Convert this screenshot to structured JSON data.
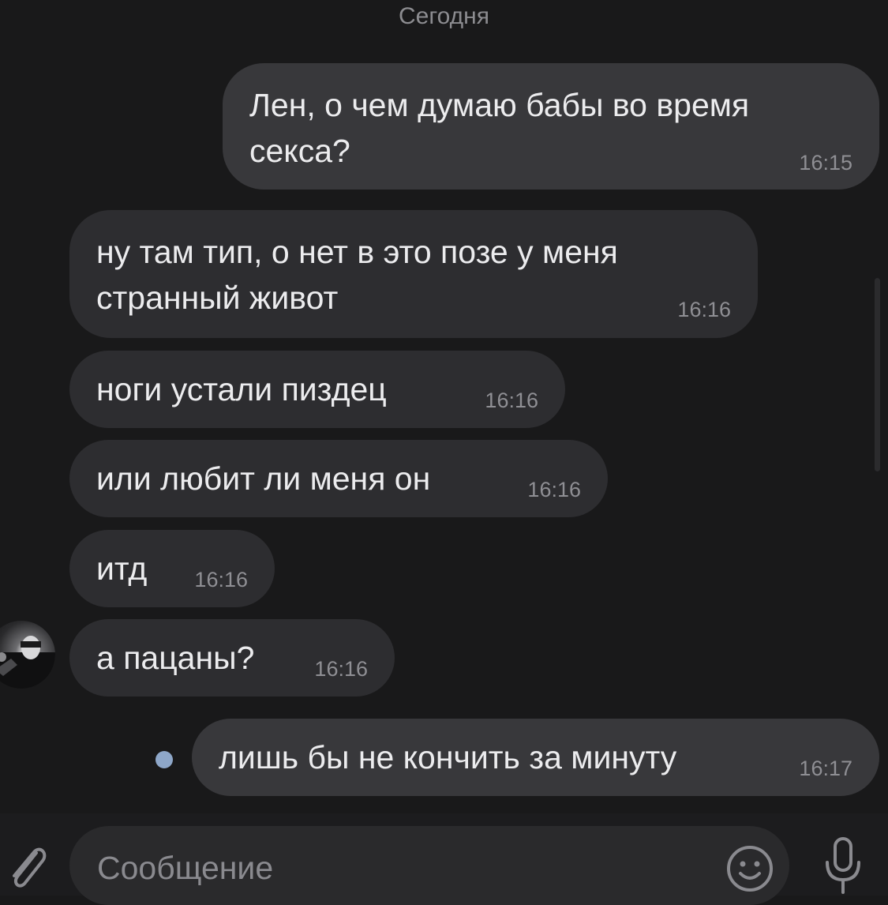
{
  "chat": {
    "day_label": "Сегодня",
    "messages": [
      {
        "direction": "outgoing",
        "lines": [
          "Лен, о чем думаю бабы во время",
          "секса?"
        ],
        "time": "16:15"
      },
      {
        "direction": "incoming",
        "lines": [
          "ну там тип, о нет в это позе у меня",
          "странный живот"
        ],
        "time": "16:16"
      },
      {
        "direction": "incoming",
        "lines": [
          "ноги устали пиздец"
        ],
        "time": "16:16"
      },
      {
        "direction": "incoming",
        "lines": [
          "или любит ли меня он"
        ],
        "time": "16:16"
      },
      {
        "direction": "incoming",
        "lines": [
          "итд"
        ],
        "time": "16:16"
      },
      {
        "direction": "incoming",
        "lines": [
          "а пацаны?"
        ],
        "time": "16:16",
        "has_avatar": true
      },
      {
        "direction": "outgoing",
        "lines": [
          "лишь бы не кончить за минуту"
        ],
        "time": "16:17",
        "unread": true
      }
    ]
  },
  "input_bar": {
    "placeholder": "Сообщение",
    "icons": [
      "paperclip-icon",
      "emoji-icon",
      "microphone-icon"
    ]
  },
  "colors": {
    "background": "#19191a",
    "bubble_incoming": "#2d2d30",
    "bubble_outgoing": "#38383b",
    "text": "#ececee",
    "time": "#8f8f94",
    "unread_dot": "#8ea7c9"
  }
}
